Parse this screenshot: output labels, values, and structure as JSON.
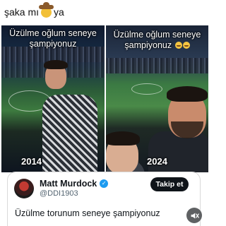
{
  "post": {
    "caption_before": "şaka mı",
    "caption_emoji": "cowboy-face-emoji",
    "caption_after": "ya"
  },
  "video": {
    "left": {
      "overlay_line1": "Üzülme oğlum seneye",
      "overlay_line2": "şampiyonuz",
      "year": "2014"
    },
    "right": {
      "overlay_line1": "Üzülme oğlum seneye",
      "overlay_line2": "şampiyonuz",
      "year": "2024",
      "emoji": "grimacing-face-emoji"
    }
  },
  "tweet": {
    "display_name": "Matt Murdock",
    "verified_mark": "✓",
    "handle": "@DDI1903",
    "follow_label": "Takip et",
    "text": "Üzülme torunum seneye şampiyonuz"
  },
  "colors": {
    "follow_button": "#0f1419",
    "verified": "#1d9bf0",
    "mute_button": "#5f6163"
  }
}
